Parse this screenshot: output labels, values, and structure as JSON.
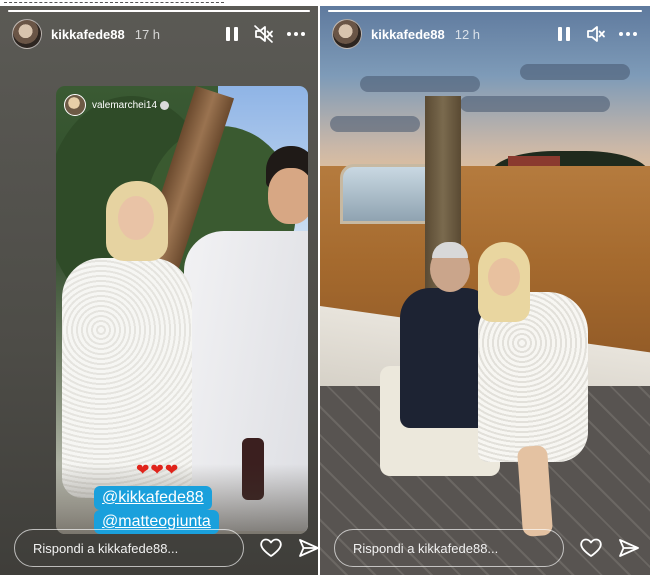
{
  "colors": {
    "left_bg": "#4f4e49",
    "text": "#ffffff",
    "mention_bg": "#1aa0dc",
    "heart": "#e0241b"
  },
  "left_story": {
    "progress": 1.0,
    "username": "kikkafede88",
    "time": "17 h",
    "icons": [
      "pause-icon",
      "mute-icon",
      "more-icon"
    ],
    "repost": {
      "username": "valemarchei14",
      "hearts": "❤❤❤",
      "mentions": [
        "@kikkafede88",
        "@matteogiunta"
      ]
    },
    "reply": {
      "placeholder": "Rispondi a kikkafede88..."
    }
  },
  "right_story": {
    "progress": 1.0,
    "username": "kikkafede88",
    "time": "12 h",
    "icons": [
      "pause-icon",
      "mute-icon",
      "more-icon"
    ],
    "reply": {
      "placeholder": "Rispondi a kikkafede88..."
    }
  }
}
